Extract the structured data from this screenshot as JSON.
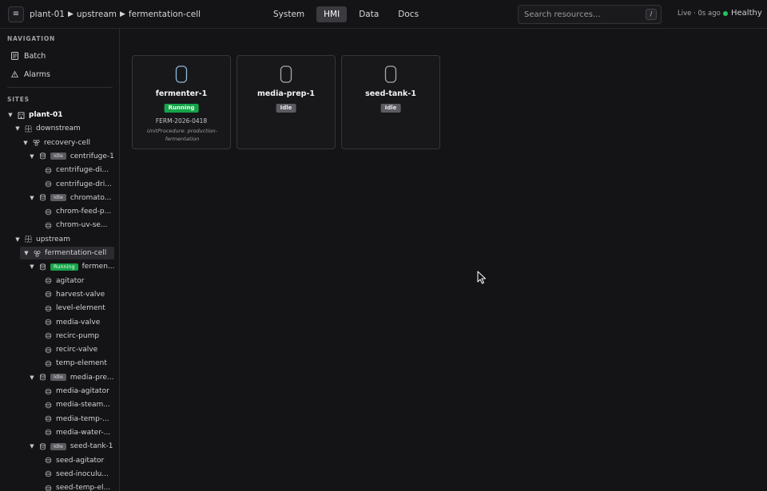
{
  "header": {
    "menu_icon": "hamburger-icon",
    "breadcrumb": [
      "plant-01",
      "upstream",
      "fermentation-cell"
    ],
    "breadcrumb_sep": "▶",
    "tabs": [
      {
        "label": "System",
        "active": false
      },
      {
        "label": "HMI",
        "active": true
      },
      {
        "label": "Data",
        "active": false
      },
      {
        "label": "Docs",
        "active": false
      }
    ],
    "search": {
      "placeholder": "Search resources...",
      "shortcut": "/"
    },
    "live_status": "Live · 0s ago",
    "health": "Healthy",
    "health_color": "#22c55e"
  },
  "sidebar": {
    "nav_title": "NAVIGATION",
    "nav_items": [
      {
        "label": "Batch",
        "icon": "document-icon"
      },
      {
        "label": "Alarms",
        "icon": "warning-icon"
      }
    ],
    "sites_title": "SITES",
    "tree": [
      {
        "label": "plant-01",
        "icon": "building-icon",
        "level": 0
      },
      {
        "label": "downstream",
        "icon": "area-icon",
        "level": 1
      },
      {
        "label": "recovery-cell",
        "icon": "cell-icon",
        "level": 2
      },
      {
        "label": "centrifuge-1",
        "icon": "unit-icon",
        "level": 3,
        "badge": "Idle"
      },
      {
        "label": "centrifuge-di...",
        "icon": "module-icon",
        "level": 4
      },
      {
        "label": "centrifuge-dri...",
        "icon": "module-icon",
        "level": 4
      },
      {
        "label": "chromato...",
        "icon": "unit-icon",
        "level": 3,
        "badge": "Idle"
      },
      {
        "label": "chrom-feed-p...",
        "icon": "module-icon",
        "level": 4
      },
      {
        "label": "chrom-uv-se...",
        "icon": "module-icon",
        "level": 4
      },
      {
        "label": "upstream",
        "icon": "area-icon",
        "level": 1
      },
      {
        "label": "fermentation-cell",
        "icon": "cell-icon",
        "level": 2,
        "selected": true
      },
      {
        "label": "fermen...",
        "icon": "unit-icon",
        "level": 3,
        "badge": "Running"
      },
      {
        "label": "agitator",
        "icon": "module-icon",
        "level": 4
      },
      {
        "label": "harvest-valve",
        "icon": "module-icon",
        "level": 4
      },
      {
        "label": "level-element",
        "icon": "module-icon",
        "level": 4
      },
      {
        "label": "media-valve",
        "icon": "module-icon",
        "level": 4
      },
      {
        "label": "recirc-pump",
        "icon": "module-icon",
        "level": 4
      },
      {
        "label": "recirc-valve",
        "icon": "module-icon",
        "level": 4
      },
      {
        "label": "temp-element",
        "icon": "module-icon",
        "level": 4
      },
      {
        "label": "media-pre...",
        "icon": "unit-icon",
        "level": 3,
        "badge": "Idle"
      },
      {
        "label": "media-agitator",
        "icon": "module-icon",
        "level": 4
      },
      {
        "label": "media-steam...",
        "icon": "module-icon",
        "level": 4
      },
      {
        "label": "media-temp-...",
        "icon": "module-icon",
        "level": 4
      },
      {
        "label": "media-water-...",
        "icon": "module-icon",
        "level": 4
      },
      {
        "label": "seed-tank-1",
        "icon": "unit-icon",
        "level": 3,
        "badge": "Idle"
      },
      {
        "label": "seed-agitator",
        "icon": "module-icon",
        "level": 4
      },
      {
        "label": "seed-inoculu...",
        "icon": "module-icon",
        "level": 4
      },
      {
        "label": "seed-temp-el...",
        "icon": "module-icon",
        "level": 4
      }
    ]
  },
  "main": {
    "cards": [
      {
        "title": "fermenter-1",
        "status": "Running",
        "batch": "FERM-2026-0418",
        "procedure": "UnitProcedure: production-fermentation",
        "icon": "vessel-icon"
      },
      {
        "title": "media-prep-1",
        "status": "Idle",
        "icon": "vessel-icon"
      },
      {
        "title": "seed-tank-1",
        "status": "Idle",
        "icon": "vessel-icon"
      }
    ]
  },
  "colors": {
    "running": "#16a34a",
    "idle": "#5b5b61",
    "accent_vessel_active": "#8fb8d8"
  }
}
